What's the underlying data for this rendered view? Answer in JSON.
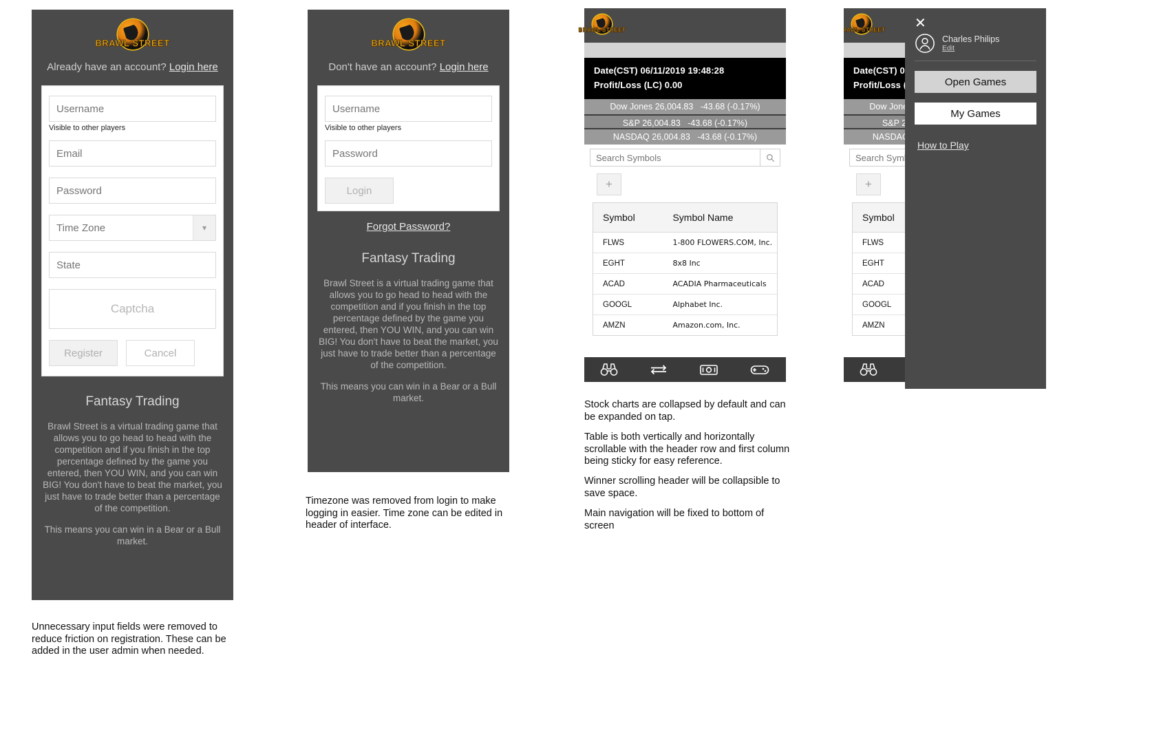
{
  "brand": {
    "name": "BRAWL STREET",
    "logo_icon": "brawl-street-logo-icon",
    "accent": "#f5b81c"
  },
  "panel_register": {
    "account_prompt": "Already have an account?",
    "account_link": "Login here",
    "fields": {
      "username_placeholder": "Username",
      "username_hint": "Visible to other players",
      "email_placeholder": "Email",
      "password_placeholder": "Password",
      "timezone_placeholder": "Time Zone",
      "state_placeholder": "State",
      "captcha_placeholder": "Captcha"
    },
    "buttons": {
      "register": "Register",
      "cancel": "Cancel"
    },
    "info": {
      "title": "Fantasy Trading",
      "paragraph1": "Brawl Street is a virtual trading game that allows you to go head to head with the competition and if you finish in the top percentage defined by the game you entered, then YOU WIN, and you can win BIG! You don't have to beat the market, you just have to trade better than a percentage of the competition.",
      "paragraph2": "This means you can win in a Bear or a Bull market."
    },
    "annotation": "Unnecessary input fields were removed to reduce friction on registration. These can be added in the user admin when needed."
  },
  "panel_login": {
    "account_prompt": "Don't have an account?",
    "account_link": "Login here",
    "fields": {
      "username_placeholder": "Username",
      "username_hint": "Visible to other players",
      "password_placeholder": "Password"
    },
    "buttons": {
      "login": "Login"
    },
    "forgot_link": "Forgot Password?",
    "info": {
      "title": "Fantasy Trading",
      "paragraph1": "Brawl Street is a virtual trading game that allows you to go head to head with the competition and if you finish in the top percentage defined by the game you entered, then YOU WIN, and you can win BIG! You don't have to beat the market, you just have to trade better than a percentage of the competition.",
      "paragraph2": "This means you can win in a Bear or a Bull market."
    },
    "annotation": "Timezone was removed from login to make logging in easier. Time zone can be edited in header of interface."
  },
  "panel_app": {
    "status": {
      "date_line": "Date(CST) 06/11/2019 19:48:28",
      "pnl_line": "Profit/Loss (LC) 0.00"
    },
    "tickers": [
      {
        "label": "Dow Jones",
        "value": "26,004.83",
        "change": "-43.68 (-0.17%)"
      },
      {
        "label": "S&P",
        "value": "26,004.83",
        "change": "-43.68 (-0.17%)"
      },
      {
        "label": "NASDAQ",
        "value": "26,004.83",
        "change": "-43.68 (-0.17%)"
      }
    ],
    "search_placeholder": "Search Symbols",
    "search_icon": "magnifier-icon",
    "add_button_label": "+",
    "table": {
      "columns": [
        "Symbol",
        "Symbol Name"
      ],
      "rows": [
        [
          "FLWS",
          "1-800 FLOWERS.COM, Inc."
        ],
        [
          "EGHT",
          "8x8 Inc"
        ],
        [
          "ACAD",
          "ACADIA Pharmaceuticals"
        ],
        [
          "GOOGL",
          "Alphabet Inc."
        ],
        [
          "AMZN",
          "Amazon.com, Inc."
        ]
      ]
    },
    "nav_icons": [
      "binoculars-icon",
      "transfer-arrows-icon",
      "money-icon",
      "gamepad-icon"
    ],
    "annotations": [
      "Stock charts are collapsed by default and can be expanded on tap.",
      "Table is both vertically and horizontally scrollable with the header row and first column being sticky for easy reference.",
      "Winner scrolling header will be collapsible to save space.",
      "Main navigation will be fixed to bottom of screen"
    ]
  },
  "panel_drawer": {
    "close_icon": "close-icon",
    "avatar_icon": "user-avatar-icon",
    "user_name": "Charles Philips",
    "edit_link": "Edit",
    "buttons": [
      {
        "label": "Open Games",
        "style": "grey"
      },
      {
        "label": "My Games",
        "style": "white"
      }
    ],
    "how_to_play": "How to Play"
  }
}
